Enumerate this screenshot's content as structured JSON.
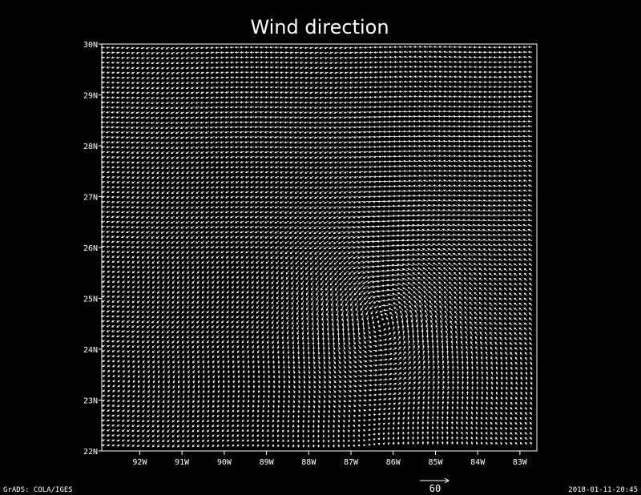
{
  "chart_data": {
    "type": "vector",
    "title": "Wind direction",
    "x_ticks": [
      "92W",
      "91W",
      "90W",
      "89W",
      "88W",
      "87W",
      "86W",
      "85W",
      "84W",
      "83W"
    ],
    "x_tick_values": [
      -92,
      -91,
      -90,
      -89,
      -88,
      -87,
      -86,
      -85,
      -84,
      -83
    ],
    "y_ticks": [
      "22N",
      "23N",
      "24N",
      "25N",
      "26N",
      "27N",
      "28N",
      "29N",
      "30N"
    ],
    "y_tick_values": [
      22,
      23,
      24,
      25,
      26,
      27,
      28,
      29,
      30
    ],
    "xlim": [
      -92.9,
      -82.6
    ],
    "ylim": [
      22,
      30
    ],
    "vortex_center": {
      "lon": -86.2,
      "lat": 24.7
    },
    "reference_vector": {
      "magnitude": "60"
    },
    "colors": {
      "background": "#000000",
      "vectors": "#ffffff"
    }
  },
  "footer": {
    "left": "GrADS: COLA/IGES",
    "right": "2018-01-11-20:45"
  }
}
